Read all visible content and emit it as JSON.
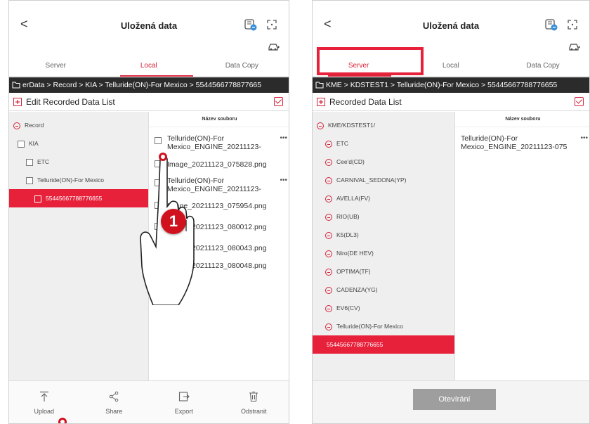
{
  "left": {
    "title": "Uložená data",
    "back": "<",
    "tabs": [
      "Server",
      "Local",
      "Data Copy"
    ],
    "breadcrumb": "erData > Record > KIA > Telluride(ON)-For Mexico > 5544566778877665",
    "list_title": "Edit Recorded Data List",
    "tree": [
      {
        "label": "Record",
        "type": "minus"
      },
      {
        "label": "KIA",
        "type": "check"
      },
      {
        "label": "ETC",
        "type": "check"
      },
      {
        "label": "Telluride(ON)-For Mexico",
        "type": "check"
      },
      {
        "label": "55445667788776655",
        "type": "check",
        "selected": true
      }
    ],
    "files_header": "Název souboru",
    "files": [
      {
        "name": "Telluride(ON)-For Mexico_ENGINE_20211123-",
        "more": "•••"
      },
      {
        "name": "Image_20211123_075828.png",
        "more": ""
      },
      {
        "name": "Telluride(ON)-For Mexico_ENGINE_20211123-",
        "more": "•••"
      },
      {
        "name": "Image_20211123_075954.png",
        "more": ""
      },
      {
        "name": "Image_20211123_080012.png",
        "more": ""
      },
      {
        "name": "Image_20211123_080043.png",
        "more": ""
      },
      {
        "name": "Image_20211123_080048.png",
        "more": ""
      }
    ],
    "bottom": [
      "Upload",
      "Share",
      "Export",
      "Odstranit"
    ],
    "step_badge": "1"
  },
  "right": {
    "title": "Uložená data",
    "back": "<",
    "tabs": [
      "Server",
      "Local",
      "Data Copy"
    ],
    "breadcrumb": "KME > KDSTEST1 > Telluride(ON)-For Mexico > 55445667788776655",
    "list_title": "Recorded Data List",
    "tree": [
      "KME/KDSTEST1/",
      "ETC",
      "Cee'd(CD)",
      "CARNIVAL_SEDONA(YP)",
      "AVELLA(FV)",
      "RIO(UB)",
      "K5(DL3)",
      "Niro(DE HEV)",
      "OPTIMA(TF)",
      "CADENZA(YG)",
      "EV6(CV)",
      "Telluride(ON)-For Mexico"
    ],
    "tree_selected": "55445667788776655",
    "files_header": "Název souboru",
    "file": {
      "name": "Telluride(ON)-For Mexico_ENGINE_20211123-075",
      "more": "•••"
    },
    "open_button": "Otevírání"
  },
  "colors": {
    "accent": "#d5233a",
    "breadcrumb_bg": "#2b2b2b",
    "tree_bg": "#efefef"
  }
}
